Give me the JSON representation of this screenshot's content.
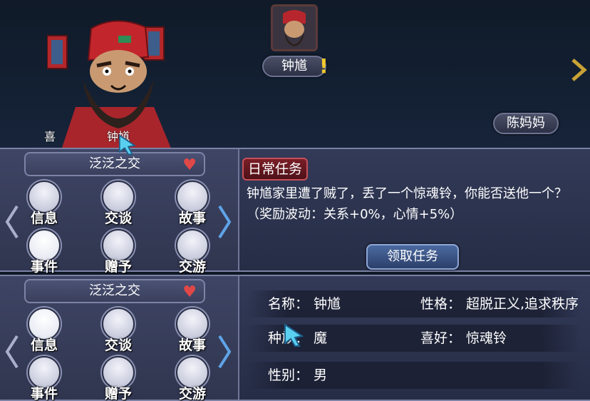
{
  "scene": {
    "npc_name": "钟馗",
    "alert_mark": "!",
    "other_npc": "陈妈妈",
    "label_left": "喜",
    "label_right": "钟馗"
  },
  "relation": {
    "label": "泛泛之交",
    "heart": "♥"
  },
  "nav_arrows": {
    "left": "prev-arrow",
    "right": "next-arrow"
  },
  "actions": [
    {
      "label": "信息",
      "icon": "info-icon"
    },
    {
      "label": "交谈",
      "icon": "chat-icon"
    },
    {
      "label": "故事",
      "icon": "book-icon"
    },
    {
      "label": "事件",
      "icon": "event-icon"
    },
    {
      "label": "赠予",
      "icon": "gift-icon"
    },
    {
      "label": "交游",
      "icon": "travel-icon"
    }
  ],
  "quest": {
    "tag": "日常任务",
    "text": "钟馗家里遭了贼了，丢了一个惊魂铃，你能否送他一个？（奖励波动：关系+0%，心情+5%）",
    "accept_button": "领取任务"
  },
  "info": {
    "name_label": "名称：",
    "name_value": "钟馗",
    "race_label": "种族：",
    "race_value": "魔",
    "gender_label": "性别：",
    "gender_value": "男",
    "personality_label": "性格：",
    "personality_value": "超脱正义,追求秩序",
    "hobby_label": "喜好：",
    "hobby_value": "惊魂铃"
  },
  "colors": {
    "panel": "#2f3652",
    "quest_tag": "#6b1a22",
    "accept_button": "#3a5588",
    "heart": "#e04848",
    "alert": "#f3c92e"
  }
}
